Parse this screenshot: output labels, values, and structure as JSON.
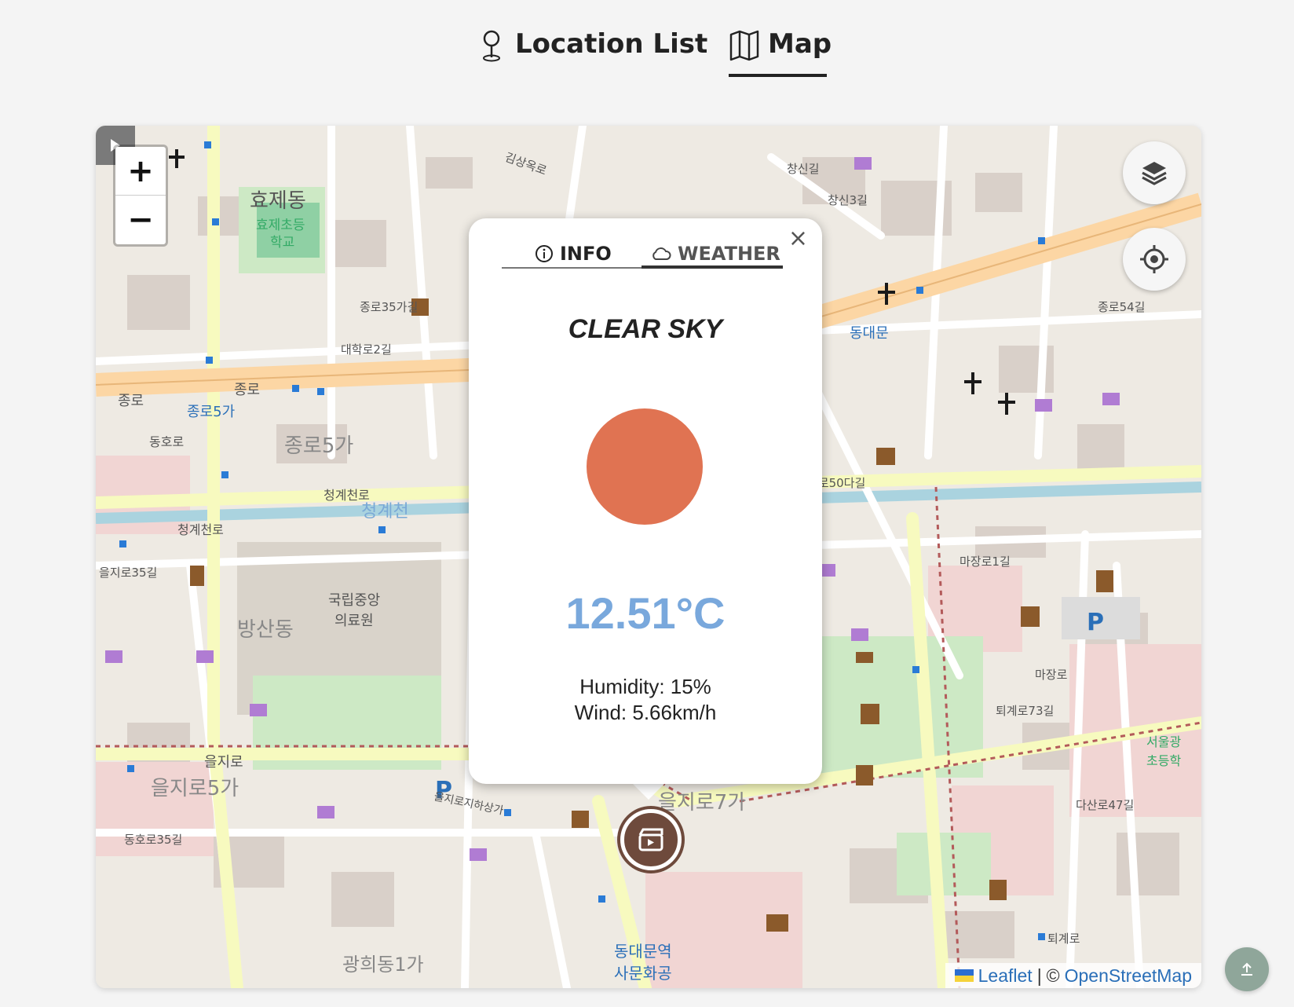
{
  "nav": {
    "tabs": [
      {
        "label": "Location List",
        "icon": "map-pin-icon"
      },
      {
        "label": "Map",
        "icon": "folded-map-icon",
        "active": true
      }
    ]
  },
  "map": {
    "zoom_in": "+",
    "zoom_out": "−",
    "attribution": {
      "leaflet": "Leaflet",
      "separator": "|",
      "copyright": "©",
      "osm": "OpenStreetMap"
    },
    "labels": {
      "hyoje_dong": "효제동",
      "hyoje_school_1": "효제초등",
      "hyoje_school_2": "학교",
      "jongno": "종로",
      "jongno5ga_station": "종로5가",
      "jongno5ga": "종로5가",
      "dongho_ro": "동호로",
      "cheonggyecheon_ro": "청계천로",
      "cheonggyecheon": "청계천",
      "nmc_1": "국립중앙",
      "nmc_2": "의료원",
      "bangsan_dong": "방산동",
      "euljiro": "을지로",
      "euljiro5ga": "을지로5가",
      "euljiro7ga": "을지로7가",
      "euljiro_underground": "을지로지하상가",
      "dongdaemun": "동대문",
      "daehak_ro2gil": "대학로2길",
      "jongno35gagil": "종로35가길",
      "gwanghui_dong1ga": "광희동1가",
      "majang_ro": "마장로",
      "majang_ro1gil": "마장로1길",
      "toegye_ro": "퇴계로",
      "toegye_ro73gil": "퇴계로73길",
      "changsin_gil": "창신길",
      "changsin3gil": "창신3길",
      "jongno54gil": "종로54길",
      "jongno50dagil": "종로50다길",
      "gimsangok_ro": "김상옥로",
      "dasan_ro47gil": "다산로47길",
      "ddp_station_1": "동대문역",
      "ddp_station_2": "사문화공",
      "euljiro35gil": "을지로35길",
      "dongho_ro35gil": "동호로35길",
      "seoul_school_1": "서울광",
      "seoul_school_2": "초등학"
    }
  },
  "popup": {
    "close": "×",
    "tabs": [
      {
        "label": "INFO",
        "icon": "info-icon"
      },
      {
        "label": "WEATHER",
        "icon": "cloud-icon",
        "active": true
      }
    ],
    "condition": "CLEAR SKY",
    "temperature": "12.51°C",
    "humidity": "Humidity: 15%",
    "wind": "Wind: 5.66km/h",
    "colors": {
      "sun": "#e07352",
      "temperature": "#79a8dc"
    }
  },
  "icons": {
    "marker": "cinema-icon",
    "layers": "layers-icon",
    "locate": "crosshair-icon",
    "sidebar_toggle": "play-icon",
    "scroll_top": "arrow-up-icon"
  }
}
